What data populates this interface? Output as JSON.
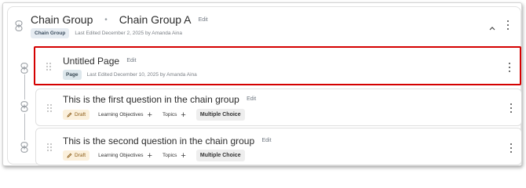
{
  "group": {
    "kind_title": "Chain Group",
    "separator": "•",
    "name": "Chain Group A",
    "edit_label": "Edit",
    "badge": "Chain Group",
    "meta": "Last Edited December 2, 2025 by Amanda Aina",
    "collapse_icon": "chevron-up-icon",
    "menu_icon": "kebab-menu-icon"
  },
  "items": [
    {
      "title": "Untitled Page",
      "edit_label": "Edit",
      "badge": "Page",
      "meta": "Last Edited December 10, 2025 by Amanda Aina",
      "selected": true
    },
    {
      "title": "This is the first question in the chain group",
      "edit_label": "Edit",
      "status": "Draft",
      "learning_objectives_label": "Learning Objectives",
      "topics_label": "Topics",
      "add_symbol": "+",
      "type": "Multiple Choice"
    },
    {
      "title": "This is the second question in the chain group",
      "edit_label": "Edit",
      "status": "Draft",
      "learning_objectives_label": "Learning Objectives",
      "topics_label": "Topics",
      "add_symbol": "+",
      "type": "Multiple Choice"
    }
  ],
  "colors": {
    "selection_outline": "#d40000",
    "draft_background": "#fbf0dc",
    "page_badge_background": "#dde7ec"
  }
}
